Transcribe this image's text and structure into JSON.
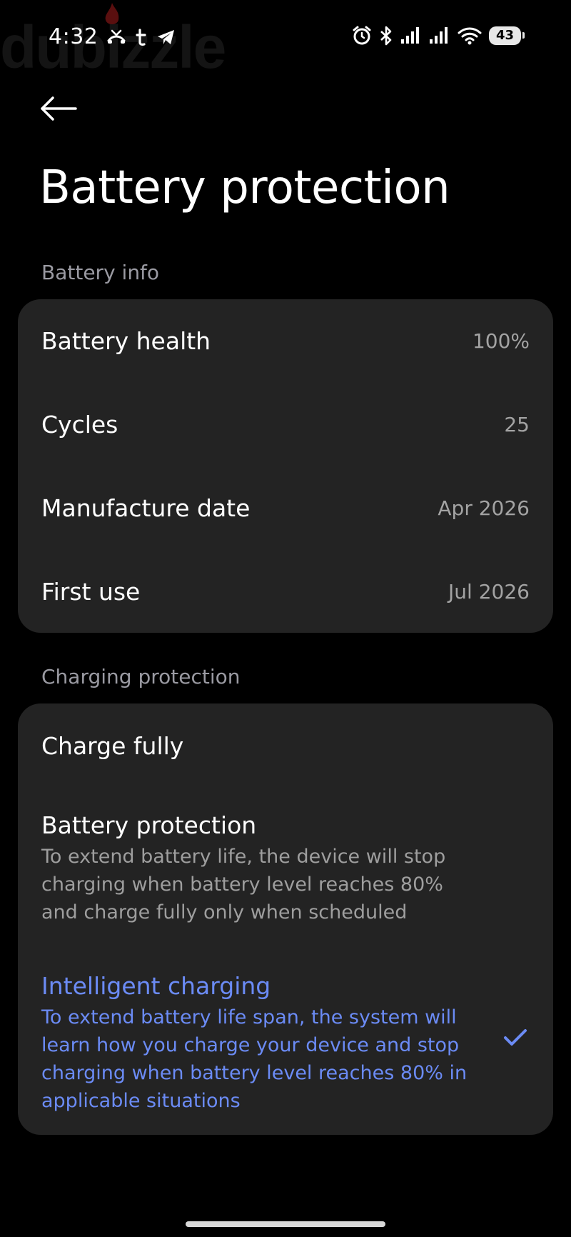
{
  "status_bar": {
    "time": "4:32",
    "battery_level": "43",
    "icons_left": [
      "missed-call-icon",
      "tumblr-icon",
      "telegram-icon"
    ],
    "icons_right": [
      "alarm-icon",
      "bluetooth-icon",
      "signal-icon",
      "signal-icon",
      "wifi-icon",
      "battery-icon"
    ]
  },
  "watermark": "dubizzle",
  "header": {
    "back_icon": "arrow-left-icon",
    "title": "Battery protection"
  },
  "battery_info": {
    "section_label": "Battery info",
    "rows": [
      {
        "label": "Battery health",
        "value": "100%"
      },
      {
        "label": "Cycles",
        "value": "25"
      },
      {
        "label": "Manufacture date",
        "value": "Apr 2026"
      },
      {
        "label": "First use",
        "value": "Jul 2026"
      }
    ]
  },
  "charging_protection": {
    "section_label": "Charging protection",
    "options": [
      {
        "title": "Charge fully",
        "description": "",
        "selected": false
      },
      {
        "title": "Battery protection",
        "description": "To extend battery life, the device will stop charging when battery level reaches 80% and charge fully only when scheduled",
        "selected": false
      },
      {
        "title": "Intelligent charging",
        "description": "To extend battery life span, the system will learn how you charge your device and stop charging when battery level reaches 80% in applicable situations",
        "selected": true
      }
    ]
  },
  "colors": {
    "background": "#000000",
    "card": "#232323",
    "accent": "#6b8bf5",
    "secondary_text": "#9e9e9e"
  }
}
